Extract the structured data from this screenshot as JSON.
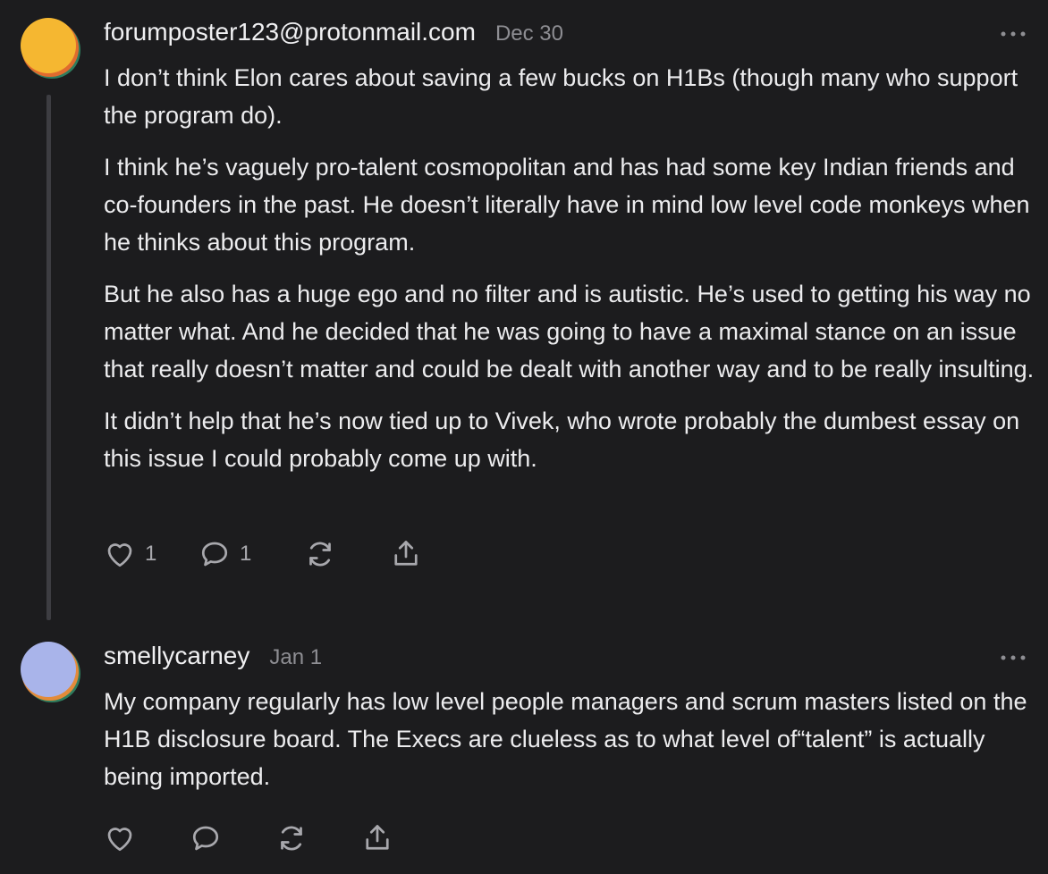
{
  "comments": [
    {
      "author": "forumposter123@protonmail.com",
      "date": "Dec 30",
      "paragraphs": [
        "I don’t think Elon cares about saving a few bucks on H1Bs (though many who support the program do).",
        "I think he’s vaguely pro-talent cosmopolitan and has had some key Indian friends and co-founders in the past. He doesn’t literally have in mind low level code monkeys when he thinks about this program.",
        "But he also has a huge ego and no filter and is autistic. He’s used to getting his way no matter what. And he decided that he was going to have a maximal stance on an issue that really doesn’t matter and could be dealt with another way and to be really insulting.",
        "It didn’t help that he’s now tied up to Vivek, who wrote probably the dumbest essay on this issue I could probably come up with."
      ],
      "like_count": "1",
      "reply_count": "1",
      "avatar_colors": [
        "#f5b731",
        "#e06b2e",
        "#2f7d5e"
      ]
    },
    {
      "author": "smellycarney",
      "date": "Jan 1",
      "paragraphs": [
        "My company regularly has low level people managers and scrum masters listed on the H1B disclosure board. The Execs are clueless as to what level of“talent” is actually being imported."
      ],
      "avatar_colors": [
        "#a9b4ea",
        "#e38b3a",
        "#2f7d5e"
      ]
    }
  ],
  "icons": {
    "like": "heart-icon",
    "reply": "speech-bubble-icon",
    "restack": "refresh-arrows-icon",
    "share": "share-upload-icon",
    "more": "ellipsis-icon"
  },
  "colors": {
    "background": "#1c1c1e",
    "text": "#ececee",
    "muted": "#8e8e93",
    "icon": "#a8a8ad",
    "thread_line": "#3d3d42"
  }
}
